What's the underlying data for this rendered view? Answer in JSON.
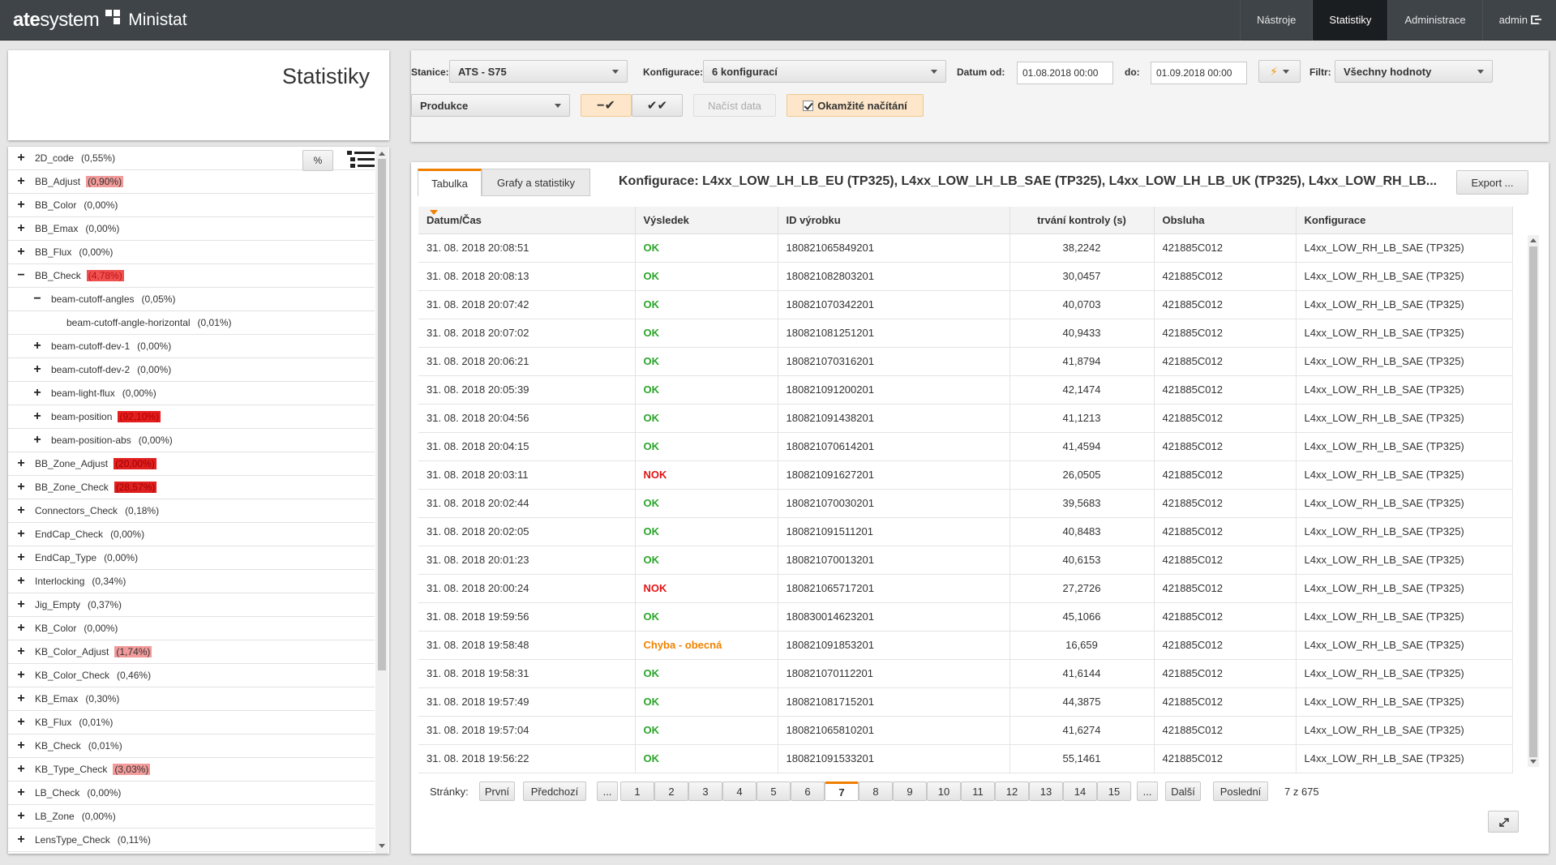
{
  "brand": {
    "part1": "ate",
    "part2": "system",
    "app": "Ministat"
  },
  "topnav": [
    {
      "label": "Nástroje",
      "active": false
    },
    {
      "label": "Statistiky",
      "active": true
    },
    {
      "label": "Administrace",
      "active": false
    },
    {
      "label": "admin",
      "active": false
    }
  ],
  "page_title": "Statistiky",
  "filters": {
    "station_label": "Stanice:",
    "station_value": "ATS - S75",
    "config_label": "Konfigurace:",
    "config_value": "6 konfigurací",
    "date_from_label": "Datum od:",
    "date_from_value": "01.08.2018 00:00",
    "date_to_label": "do:",
    "date_to_value": "01.09.2018 00:00",
    "filter_label": "Filtr:",
    "filter_value": "Všechny hodnoty",
    "mode_value": "Produkce",
    "load_label": "Načíst data",
    "instant_label": "Okamžité načítání",
    "bolt_icon": "⚡"
  },
  "tree": {
    "pct_button": "%",
    "items": [
      {
        "label": "2D_code",
        "pct": "(0,55%)",
        "toggle": "+",
        "level": 0,
        "hl": ""
      },
      {
        "label": "BB_Adjust",
        "pct": "(0,90%)",
        "toggle": "+",
        "level": 0,
        "hl": "red1"
      },
      {
        "label": "BB_Color",
        "pct": "(0,00%)",
        "toggle": "+",
        "level": 0,
        "hl": ""
      },
      {
        "label": "BB_Emax",
        "pct": "(0,00%)",
        "toggle": "+",
        "level": 0,
        "hl": ""
      },
      {
        "label": "BB_Flux",
        "pct": "(0,00%)",
        "toggle": "+",
        "level": 0,
        "hl": ""
      },
      {
        "label": "BB_Check",
        "pct": "(4,78%)",
        "toggle": "−",
        "level": 0,
        "hl": "red2"
      },
      {
        "label": "beam-cutoff-angles",
        "pct": "(0,05%)",
        "toggle": "−",
        "level": 1,
        "hl": ""
      },
      {
        "label": "beam-cutoff-angle-horizontal",
        "pct": "(0,01%)",
        "toggle": "",
        "level": 2,
        "hl": ""
      },
      {
        "label": "beam-cutoff-dev-1",
        "pct": "(0,00%)",
        "toggle": "+",
        "level": 1,
        "hl": ""
      },
      {
        "label": "beam-cutoff-dev-2",
        "pct": "(0,00%)",
        "toggle": "+",
        "level": 1,
        "hl": ""
      },
      {
        "label": "beam-light-flux",
        "pct": "(0,00%)",
        "toggle": "+",
        "level": 1,
        "hl": ""
      },
      {
        "label": "beam-position",
        "pct": "(92,10%)",
        "toggle": "+",
        "level": 1,
        "hl": "red3"
      },
      {
        "label": "beam-position-abs",
        "pct": "(0,00%)",
        "toggle": "+",
        "level": 1,
        "hl": ""
      },
      {
        "label": "BB_Zone_Adjust",
        "pct": "(20,00%)",
        "toggle": "+",
        "level": 0,
        "hl": "red4"
      },
      {
        "label": "BB_Zone_Check",
        "pct": "(28,57%)",
        "toggle": "+",
        "level": 0,
        "hl": "red4"
      },
      {
        "label": "Connectors_Check",
        "pct": "(0,18%)",
        "toggle": "+",
        "level": 0,
        "hl": ""
      },
      {
        "label": "EndCap_Check",
        "pct": "(0,00%)",
        "toggle": "+",
        "level": 0,
        "hl": ""
      },
      {
        "label": "EndCap_Type",
        "pct": "(0,00%)",
        "toggle": "+",
        "level": 0,
        "hl": ""
      },
      {
        "label": "Interlocking",
        "pct": "(0,34%)",
        "toggle": "+",
        "level": 0,
        "hl": ""
      },
      {
        "label": "Jig_Empty",
        "pct": "(0,37%)",
        "toggle": "+",
        "level": 0,
        "hl": ""
      },
      {
        "label": "KB_Color",
        "pct": "(0,00%)",
        "toggle": "+",
        "level": 0,
        "hl": ""
      },
      {
        "label": "KB_Color_Adjust",
        "pct": "(1,74%)",
        "toggle": "+",
        "level": 0,
        "hl": "red1"
      },
      {
        "label": "KB_Color_Check",
        "pct": "(0,46%)",
        "toggle": "+",
        "level": 0,
        "hl": ""
      },
      {
        "label": "KB_Emax",
        "pct": "(0,30%)",
        "toggle": "+",
        "level": 0,
        "hl": ""
      },
      {
        "label": "KB_Flux",
        "pct": "(0,01%)",
        "toggle": "+",
        "level": 0,
        "hl": ""
      },
      {
        "label": "KB_Check",
        "pct": "(0,01%)",
        "toggle": "+",
        "level": 0,
        "hl": ""
      },
      {
        "label": "KB_Type_Check",
        "pct": "(3,03%)",
        "toggle": "+",
        "level": 0,
        "hl": "red1"
      },
      {
        "label": "LB_Check",
        "pct": "(0,00%)",
        "toggle": "+",
        "level": 0,
        "hl": ""
      },
      {
        "label": "LB_Zone",
        "pct": "(0,00%)",
        "toggle": "+",
        "level": 0,
        "hl": ""
      },
      {
        "label": "LensType_Check",
        "pct": "(0,11%)",
        "toggle": "+",
        "level": 0,
        "hl": ""
      }
    ]
  },
  "main": {
    "tabs": [
      {
        "label": "Tabulka",
        "active": true
      },
      {
        "label": "Grafy a statistiky",
        "active": false
      }
    ],
    "config_title": "Konfigurace: L4xx_LOW_LH_LB_EU (TP325), L4xx_LOW_LH_LB_SAE (TP325), L4xx_LOW_LH_LB_UK (TP325), L4xx_LOW_RH_LB...",
    "export_label": "Export ...",
    "columns": [
      "Datum/Čas",
      "Výsledek",
      "ID výrobku",
      "trvání kontroly (s)",
      "Obsluha",
      "Konfigurace"
    ],
    "rows": [
      [
        "31. 08. 2018 20:08:51",
        "OK",
        "180821065849201",
        "38,2242",
        "421885C012",
        "L4xx_LOW_RH_LB_SAE (TP325)"
      ],
      [
        "31. 08. 2018 20:08:13",
        "OK",
        "180821082803201",
        "30,0457",
        "421885C012",
        "L4xx_LOW_RH_LB_SAE (TP325)"
      ],
      [
        "31. 08. 2018 20:07:42",
        "OK",
        "180821070342201",
        "40,0703",
        "421885C012",
        "L4xx_LOW_RH_LB_SAE (TP325)"
      ],
      [
        "31. 08. 2018 20:07:02",
        "OK",
        "180821081251201",
        "40,9433",
        "421885C012",
        "L4xx_LOW_RH_LB_SAE (TP325)"
      ],
      [
        "31. 08. 2018 20:06:21",
        "OK",
        "180821070316201",
        "41,8794",
        "421885C012",
        "L4xx_LOW_RH_LB_SAE (TP325)"
      ],
      [
        "31. 08. 2018 20:05:39",
        "OK",
        "180821091200201",
        "42,1474",
        "421885C012",
        "L4xx_LOW_RH_LB_SAE (TP325)"
      ],
      [
        "31. 08. 2018 20:04:56",
        "OK",
        "180821091438201",
        "41,1213",
        "421885C012",
        "L4xx_LOW_RH_LB_SAE (TP325)"
      ],
      [
        "31. 08. 2018 20:04:15",
        "OK",
        "180821070614201",
        "41,4594",
        "421885C012",
        "L4xx_LOW_RH_LB_SAE (TP325)"
      ],
      [
        "31. 08. 2018 20:03:11",
        "NOK",
        "180821091627201",
        "26,0505",
        "421885C012",
        "L4xx_LOW_RH_LB_SAE (TP325)"
      ],
      [
        "31. 08. 2018 20:02:44",
        "OK",
        "180821070030201",
        "39,5683",
        "421885C012",
        "L4xx_LOW_RH_LB_SAE (TP325)"
      ],
      [
        "31. 08. 2018 20:02:05",
        "OK",
        "180821091511201",
        "40,8483",
        "421885C012",
        "L4xx_LOW_RH_LB_SAE (TP325)"
      ],
      [
        "31. 08. 2018 20:01:23",
        "OK",
        "180821070013201",
        "40,6153",
        "421885C012",
        "L4xx_LOW_RH_LB_SAE (TP325)"
      ],
      [
        "31. 08. 2018 20:00:24",
        "NOK",
        "180821065717201",
        "27,2726",
        "421885C012",
        "L4xx_LOW_RH_LB_SAE (TP325)"
      ],
      [
        "31. 08. 2018 19:59:56",
        "OK",
        "180830014623201",
        "45,1066",
        "421885C012",
        "L4xx_LOW_RH_LB_SAE (TP325)"
      ],
      [
        "31. 08. 2018 19:58:48",
        "Chyba - obecná",
        "180821091853201",
        "16,659",
        "421885C012",
        "L4xx_LOW_RH_LB_SAE (TP325)"
      ],
      [
        "31. 08. 2018 19:58:31",
        "OK",
        "180821070112201",
        "41,6144",
        "421885C012",
        "L4xx_LOW_RH_LB_SAE (TP325)"
      ],
      [
        "31. 08. 2018 19:57:49",
        "OK",
        "180821081715201",
        "44,3875",
        "421885C012",
        "L4xx_LOW_RH_LB_SAE (TP325)"
      ],
      [
        "31. 08. 2018 19:57:04",
        "OK",
        "180821065810201",
        "41,6274",
        "421885C012",
        "L4xx_LOW_RH_LB_SAE (TP325)"
      ],
      [
        "31. 08. 2018 19:56:22",
        "OK",
        "180821091533201",
        "55,1461",
        "421885C012",
        "L4xx_LOW_RH_LB_SAE (TP325)"
      ]
    ],
    "pager": {
      "label": "Stránky:",
      "first": "První",
      "prev": "Předchozí",
      "ellipsis": "...",
      "pages": [
        "1",
        "2",
        "3",
        "4",
        "5",
        "6",
        "7",
        "8",
        "9",
        "10",
        "11",
        "12",
        "13",
        "14",
        "15"
      ],
      "active_page": "7",
      "next": "Další",
      "last": "Poslední",
      "count": "7 z 675"
    }
  },
  "colors": {
    "accent": "#f07f00",
    "ok": "#2aa52a",
    "nok": "#e01515",
    "error": "#f08300",
    "topbar": "#3f4448"
  }
}
